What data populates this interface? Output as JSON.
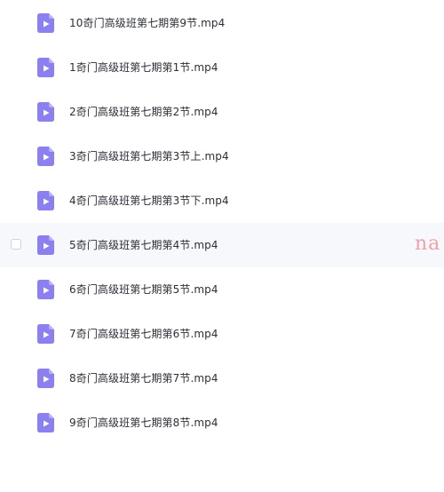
{
  "icons": {
    "file": "video-file-icon",
    "file_color": "#8c80f0",
    "file_fold_color": "#b9b0f7"
  },
  "files": [
    {
      "name": "10奇门高级班第七期第9节.mp4"
    },
    {
      "name": "1奇门高级班第七期第1节.mp4"
    },
    {
      "name": "2奇门高级班第七期第2节.mp4"
    },
    {
      "name": "3奇门高级班第七期第3节上.mp4"
    },
    {
      "name": "4奇门高级班第七期第3节下.mp4"
    },
    {
      "name": "5奇门高级班第七期第4节.mp4",
      "hovered": true
    },
    {
      "name": "6奇门高级班第七期第5节.mp4"
    },
    {
      "name": "7奇门高级班第七期第6节.mp4"
    },
    {
      "name": "8奇门高级班第七期第7节.mp4"
    },
    {
      "name": "9奇门高级班第七期第8节.mp4"
    }
  ],
  "watermark": "na"
}
